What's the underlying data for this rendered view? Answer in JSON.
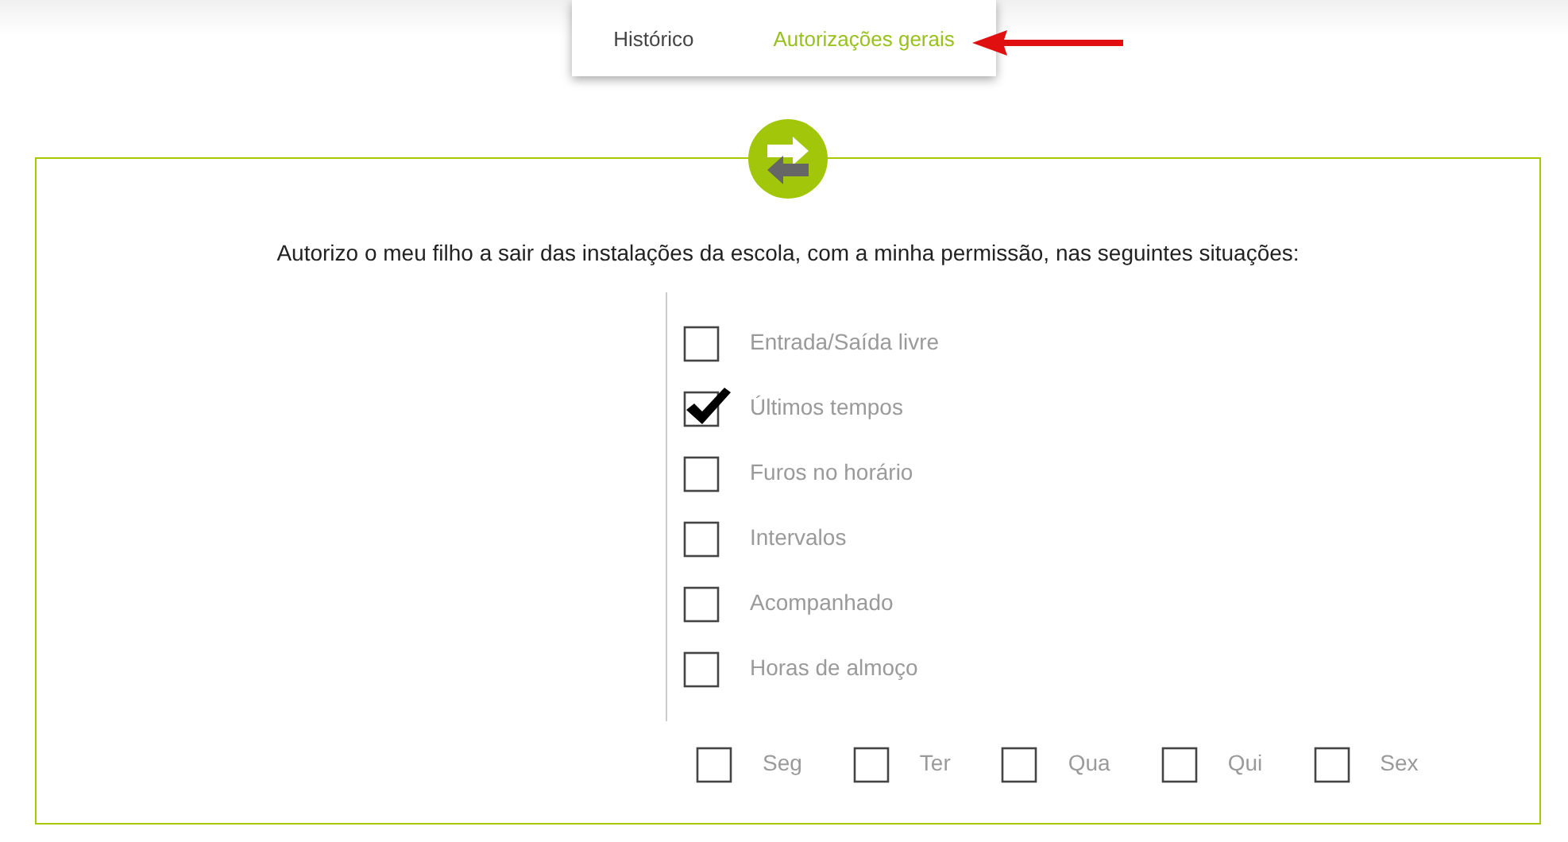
{
  "tabs": [
    {
      "label": "Histórico",
      "selected": false
    },
    {
      "label": "Autorizações gerais",
      "selected": true
    }
  ],
  "panel": {
    "statement": "Autorizo o meu filho a sair das instalações da escola, com a minha permissão, nas seguintes situações:",
    "situations": [
      {
        "label": "Entrada/Saída livre",
        "checked": false
      },
      {
        "label": "Últimos tempos",
        "checked": true
      },
      {
        "label": "Furos no horário",
        "checked": false
      },
      {
        "label": "Intervalos",
        "checked": false
      },
      {
        "label": "Acompanhado",
        "checked": false
      },
      {
        "label": "Horas de almoço",
        "checked": false
      }
    ],
    "days": [
      {
        "label": "Seg",
        "checked": false
      },
      {
        "label": "Ter",
        "checked": false
      },
      {
        "label": "Qua",
        "checked": false
      },
      {
        "label": "Qui",
        "checked": false
      },
      {
        "label": "Sex",
        "checked": false
      }
    ]
  }
}
